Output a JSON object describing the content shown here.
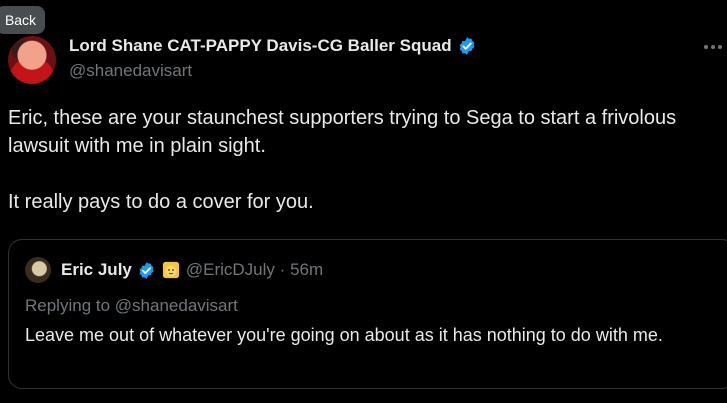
{
  "nav": {
    "back_label": "Back"
  },
  "tweet": {
    "author_name": "Lord Shane CAT-PAPPY Davis-CG Baller Squad",
    "author_handle": "@shanedavisart",
    "verified": true,
    "text": "Eric, these are your staunchest supporters trying to Sega to start a frivolous lawsuit with me in plain sight.\n\nIt really pays to do a cover for you."
  },
  "quote": {
    "author_name": "Eric July",
    "verified": true,
    "author_handle": "@EricDJuly",
    "separator": "·",
    "timestamp": "56m",
    "replying_prefix": "Replying to",
    "replying_handle": "@shanedavisart",
    "text": "Leave me out of whatever you're going on about as it has nothing to do with me."
  },
  "icons": {
    "verified": "verified-badge-icon",
    "more": "more-options-icon",
    "emoji": "cat-emoji-icon"
  },
  "colors": {
    "background": "#000000",
    "text": "#e7e9ea",
    "muted": "#71767b",
    "verified_blue": "#1d9bf0",
    "border": "#2f3336"
  }
}
